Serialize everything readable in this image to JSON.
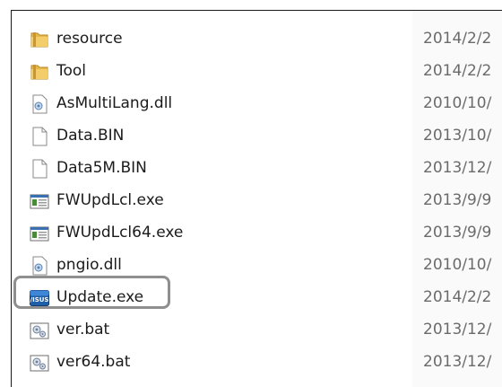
{
  "files": [
    {
      "name": "resource",
      "date": "2014/2/2",
      "icon": "folder-icon"
    },
    {
      "name": "Tool",
      "date": "2014/2/2",
      "icon": "folder-icon"
    },
    {
      "name": "AsMultiLang.dll",
      "date": "2010/10/",
      "icon": "dll-icon"
    },
    {
      "name": "Data.BIN",
      "date": "2013/10/",
      "icon": "blank-file-icon"
    },
    {
      "name": "Data5M.BIN",
      "date": "2013/12/",
      "icon": "blank-file-icon"
    },
    {
      "name": "FWUpdLcl.exe",
      "date": "2013/9/9",
      "icon": "exe-window-icon"
    },
    {
      "name": "FWUpdLcl64.exe",
      "date": "2013/9/9",
      "icon": "exe-window-icon"
    },
    {
      "name": "pngio.dll",
      "date": "2010/10/",
      "icon": "dll-icon"
    },
    {
      "name": "Update.exe",
      "date": "2014/2/2",
      "icon": "asus-app-icon",
      "highlighted": true
    },
    {
      "name": "ver.bat",
      "date": "2013/12/",
      "icon": "batch-file-icon"
    },
    {
      "name": "ver64.bat",
      "date": "2013/12/",
      "icon": "batch-file-icon"
    }
  ],
  "asus_label": "/ISUS",
  "colors": {
    "folder": "#e8b84a",
    "highlight_border": "#8f8f8f",
    "asus_blue": "#1f5fa8"
  }
}
